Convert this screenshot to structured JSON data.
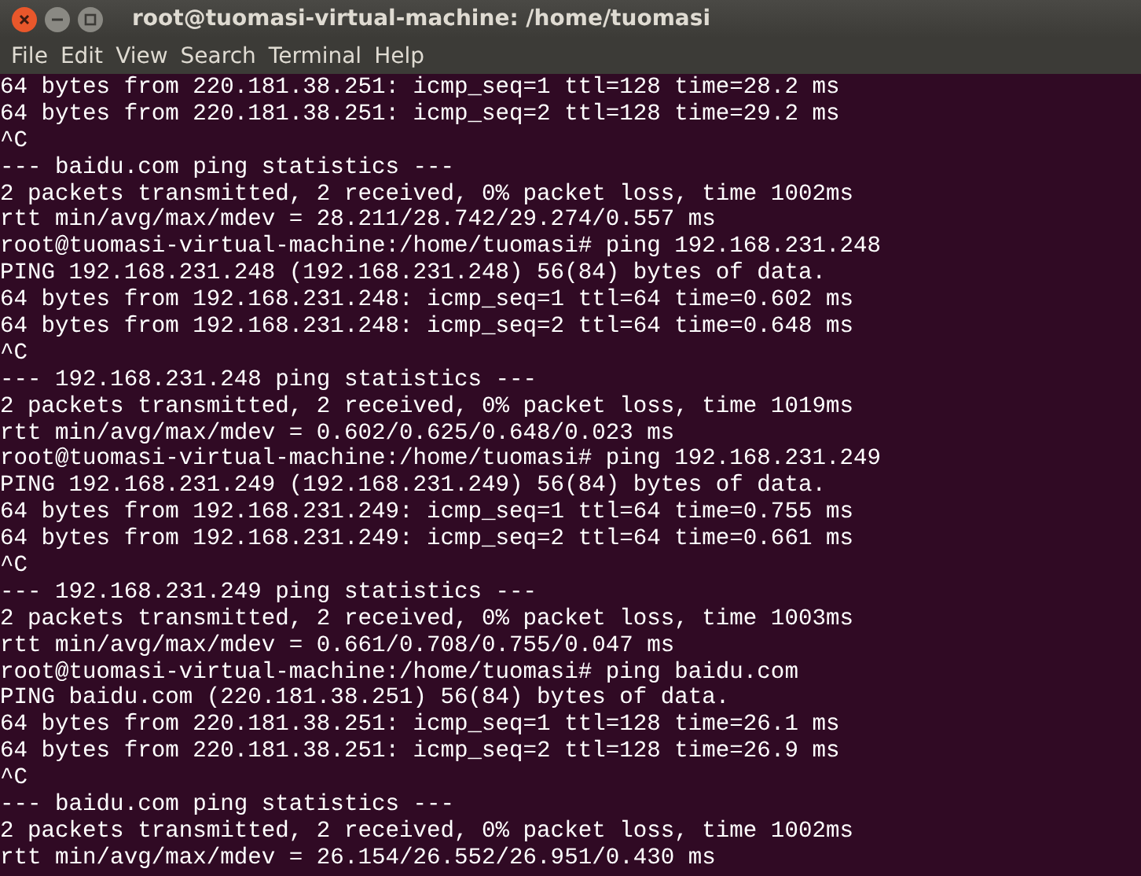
{
  "window": {
    "title": "root@tuomasi-virtual-machine: /home/tuomasi"
  },
  "menu": [
    "File",
    "Edit",
    "View",
    "Search",
    "Terminal",
    "Help"
  ],
  "terminal": {
    "lines": [
      "64 bytes from 220.181.38.251: icmp_seq=1 ttl=128 time=28.2 ms",
      "64 bytes from 220.181.38.251: icmp_seq=2 ttl=128 time=29.2 ms",
      "^C",
      "--- baidu.com ping statistics ---",
      "2 packets transmitted, 2 received, 0% packet loss, time 1002ms",
      "rtt min/avg/max/mdev = 28.211/28.742/29.274/0.557 ms",
      "root@tuomasi-virtual-machine:/home/tuomasi# ping 192.168.231.248",
      "PING 192.168.231.248 (192.168.231.248) 56(84) bytes of data.",
      "64 bytes from 192.168.231.248: icmp_seq=1 ttl=64 time=0.602 ms",
      "64 bytes from 192.168.231.248: icmp_seq=2 ttl=64 time=0.648 ms",
      "^C",
      "--- 192.168.231.248 ping statistics ---",
      "2 packets transmitted, 2 received, 0% packet loss, time 1019ms",
      "rtt min/avg/max/mdev = 0.602/0.625/0.648/0.023 ms",
      "root@tuomasi-virtual-machine:/home/tuomasi# ping 192.168.231.249",
      "PING 192.168.231.249 (192.168.231.249) 56(84) bytes of data.",
      "64 bytes from 192.168.231.249: icmp_seq=1 ttl=64 time=0.755 ms",
      "64 bytes from 192.168.231.249: icmp_seq=2 ttl=64 time=0.661 ms",
      "^C",
      "--- 192.168.231.249 ping statistics ---",
      "2 packets transmitted, 2 received, 0% packet loss, time 1003ms",
      "rtt min/avg/max/mdev = 0.661/0.708/0.755/0.047 ms",
      "root@tuomasi-virtual-machine:/home/tuomasi# ping baidu.com",
      "PING baidu.com (220.181.38.251) 56(84) bytes of data.",
      "64 bytes from 220.181.38.251: icmp_seq=1 ttl=128 time=26.1 ms",
      "64 bytes from 220.181.38.251: icmp_seq=2 ttl=128 time=26.9 ms",
      "^C",
      "--- baidu.com ping statistics ---",
      "2 packets transmitted, 2 received, 0% packet loss, time 1002ms",
      "rtt min/avg/max/mdev = 26.154/26.552/26.951/0.430 ms"
    ]
  }
}
